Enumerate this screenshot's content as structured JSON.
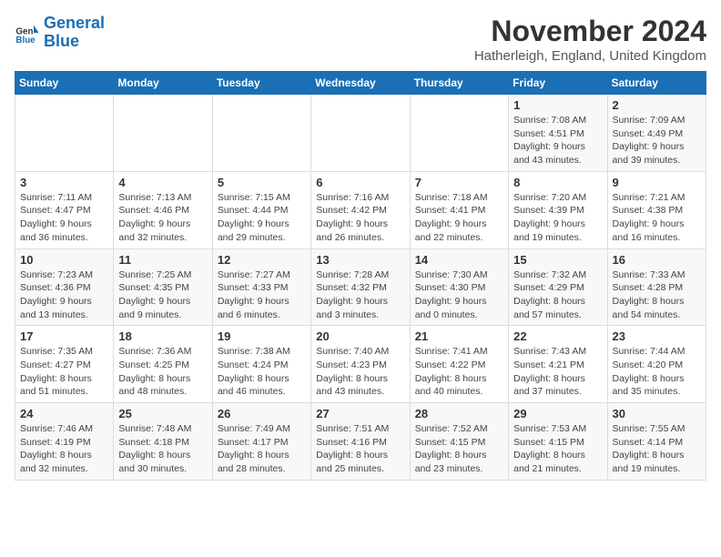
{
  "logo": {
    "text1": "General",
    "text2": "Blue"
  },
  "title": "November 2024",
  "location": "Hatherleigh, England, United Kingdom",
  "weekdays": [
    "Sunday",
    "Monday",
    "Tuesday",
    "Wednesday",
    "Thursday",
    "Friday",
    "Saturday"
  ],
  "weeks": [
    [
      null,
      null,
      null,
      null,
      null,
      {
        "day": "1",
        "sunrise": "7:08 AM",
        "sunset": "4:51 PM",
        "daylight": "9 hours and 43 minutes."
      },
      {
        "day": "2",
        "sunrise": "7:09 AM",
        "sunset": "4:49 PM",
        "daylight": "9 hours and 39 minutes."
      }
    ],
    [
      {
        "day": "3",
        "sunrise": "7:11 AM",
        "sunset": "4:47 PM",
        "daylight": "9 hours and 36 minutes."
      },
      {
        "day": "4",
        "sunrise": "7:13 AM",
        "sunset": "4:46 PM",
        "daylight": "9 hours and 32 minutes."
      },
      {
        "day": "5",
        "sunrise": "7:15 AM",
        "sunset": "4:44 PM",
        "daylight": "9 hours and 29 minutes."
      },
      {
        "day": "6",
        "sunrise": "7:16 AM",
        "sunset": "4:42 PM",
        "daylight": "9 hours and 26 minutes."
      },
      {
        "day": "7",
        "sunrise": "7:18 AM",
        "sunset": "4:41 PM",
        "daylight": "9 hours and 22 minutes."
      },
      {
        "day": "8",
        "sunrise": "7:20 AM",
        "sunset": "4:39 PM",
        "daylight": "9 hours and 19 minutes."
      },
      {
        "day": "9",
        "sunrise": "7:21 AM",
        "sunset": "4:38 PM",
        "daylight": "9 hours and 16 minutes."
      }
    ],
    [
      {
        "day": "10",
        "sunrise": "7:23 AM",
        "sunset": "4:36 PM",
        "daylight": "9 hours and 13 minutes."
      },
      {
        "day": "11",
        "sunrise": "7:25 AM",
        "sunset": "4:35 PM",
        "daylight": "9 hours and 9 minutes."
      },
      {
        "day": "12",
        "sunrise": "7:27 AM",
        "sunset": "4:33 PM",
        "daylight": "9 hours and 6 minutes."
      },
      {
        "day": "13",
        "sunrise": "7:28 AM",
        "sunset": "4:32 PM",
        "daylight": "9 hours and 3 minutes."
      },
      {
        "day": "14",
        "sunrise": "7:30 AM",
        "sunset": "4:30 PM",
        "daylight": "9 hours and 0 minutes."
      },
      {
        "day": "15",
        "sunrise": "7:32 AM",
        "sunset": "4:29 PM",
        "daylight": "8 hours and 57 minutes."
      },
      {
        "day": "16",
        "sunrise": "7:33 AM",
        "sunset": "4:28 PM",
        "daylight": "8 hours and 54 minutes."
      }
    ],
    [
      {
        "day": "17",
        "sunrise": "7:35 AM",
        "sunset": "4:27 PM",
        "daylight": "8 hours and 51 minutes."
      },
      {
        "day": "18",
        "sunrise": "7:36 AM",
        "sunset": "4:25 PM",
        "daylight": "8 hours and 48 minutes."
      },
      {
        "day": "19",
        "sunrise": "7:38 AM",
        "sunset": "4:24 PM",
        "daylight": "8 hours and 46 minutes."
      },
      {
        "day": "20",
        "sunrise": "7:40 AM",
        "sunset": "4:23 PM",
        "daylight": "8 hours and 43 minutes."
      },
      {
        "day": "21",
        "sunrise": "7:41 AM",
        "sunset": "4:22 PM",
        "daylight": "8 hours and 40 minutes."
      },
      {
        "day": "22",
        "sunrise": "7:43 AM",
        "sunset": "4:21 PM",
        "daylight": "8 hours and 37 minutes."
      },
      {
        "day": "23",
        "sunrise": "7:44 AM",
        "sunset": "4:20 PM",
        "daylight": "8 hours and 35 minutes."
      }
    ],
    [
      {
        "day": "24",
        "sunrise": "7:46 AM",
        "sunset": "4:19 PM",
        "daylight": "8 hours and 32 minutes."
      },
      {
        "day": "25",
        "sunrise": "7:48 AM",
        "sunset": "4:18 PM",
        "daylight": "8 hours and 30 minutes."
      },
      {
        "day": "26",
        "sunrise": "7:49 AM",
        "sunset": "4:17 PM",
        "daylight": "8 hours and 28 minutes."
      },
      {
        "day": "27",
        "sunrise": "7:51 AM",
        "sunset": "4:16 PM",
        "daylight": "8 hours and 25 minutes."
      },
      {
        "day": "28",
        "sunrise": "7:52 AM",
        "sunset": "4:15 PM",
        "daylight": "8 hours and 23 minutes."
      },
      {
        "day": "29",
        "sunrise": "7:53 AM",
        "sunset": "4:15 PM",
        "daylight": "8 hours and 21 minutes."
      },
      {
        "day": "30",
        "sunrise": "7:55 AM",
        "sunset": "4:14 PM",
        "daylight": "8 hours and 19 minutes."
      }
    ]
  ]
}
